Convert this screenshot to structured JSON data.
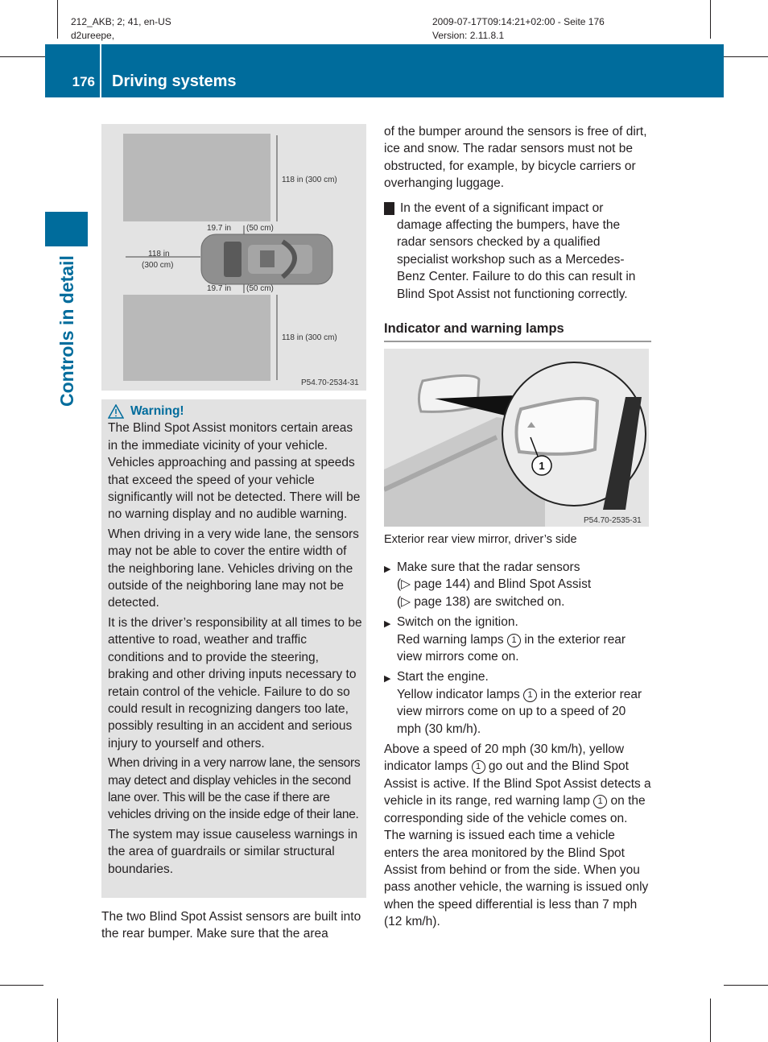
{
  "meta": {
    "left_line1": "212_AKB; 2; 41, en-US",
    "left_line2": "d2ureepe,",
    "right_line1": "2009-07-17T09:14:21+02:00 - Seite 176",
    "right_line2": "Version: 2.11.8.1"
  },
  "header": {
    "page_number": "176",
    "title": "Driving systems",
    "accent_color": "#006c9c"
  },
  "sidebar": {
    "section_label": "Controls in detail"
  },
  "figure1": {
    "labels": {
      "top_zone": "118 in (300 cm)",
      "bottom_zone": "118 in (300 cm)",
      "rear_distance_line1": "118 in",
      "rear_distance_line2": "(300 cm)",
      "upper_offset_in": "19.7 in",
      "upper_offset_cm": "(50 cm)",
      "lower_offset_in": "19.7 in",
      "lower_offset_cm": "(50 cm)"
    },
    "code": "P54.70-2534-31"
  },
  "warning": {
    "title": "Warning!",
    "paragraphs": [
      "The Blind Spot Assist monitors certain areas in the immediate vicinity of your vehicle. Vehicles approaching and passing at speeds that exceed the speed of your vehicle significantly will not be detected. There will be no warning display and no audible warning.",
      "When driving in a very wide lane, the sensors may not be able to cover the entire width of the neighboring lane. Vehicles driving on the outside of the neighboring lane may not be detected.",
      "It is the driver’s responsibility at all times to be attentive to road, weather and traffic conditions and to provide the steering, braking and other driving inputs necessary to retain control of the vehicle. Failure to do so could result in recognizing dangers too late, possibly resulting in an accident and serious injury to yourself and others.",
      "When driving in a very narrow lane, the sensors may detect and display vehicles in the second lane over. This will be the case if there are vehicles driving on the inside edge of their lane.",
      "The system may issue causeless warnings in the area of guardrails or similar structural boundaries."
    ]
  },
  "left_tail": "The two Blind Spot Assist sensors are built into the rear bumper. Make sure that the area",
  "right": {
    "intro": "of the bumper around the sensors is free of dirt, ice and snow. The radar sensors must not be obstructed, for example, by bicycle carriers or overhanging luggage.",
    "notice": "In the event of a significant impact or damage affecting the bumpers, have the radar sensors checked by a qualified specialist workshop such as a Mercedes-Benz Center. Failure to do this can result in Blind Spot Assist not functioning correctly.",
    "heading": "Indicator and warning lamps",
    "figure2": {
      "callout": "1",
      "code": "P54.70-2535-31"
    },
    "caption": "Exterior rear view mirror, driver’s side",
    "steps": [
      {
        "line1": "Make sure that the radar sensors",
        "line2": "(▷ page 144) and Blind Spot Assist",
        "line3": "(▷ page 138) are switched on."
      },
      {
        "line1": "Switch on the ignition.",
        "result_pre": "Red warning lamps",
        "result_post": "in the exterior rear view mirrors come on."
      },
      {
        "line1": "Start the engine.",
        "result_pre": "Yellow indicator lamps",
        "result_post": "in the exterior rear view mirrors come on up to a speed of 20 mph (30 km/h)."
      }
    ],
    "callout_ref": "1",
    "final_pre": "Above a speed of 20 mph (30 km/h), yellow indicator lamps",
    "final_mid": "go out and the Blind Spot Assist is active. If the Blind Spot Assist detects a vehicle in its range, red warning lamp",
    "final_post": "on the corresponding side of the vehicle comes on. The warning is issued each time a vehicle enters the area monitored by the Blind Spot Assist from behind or from the side. When you pass another vehicle, the warning is issued only when the speed differential is less than 7 mph (12 km/h)."
  }
}
